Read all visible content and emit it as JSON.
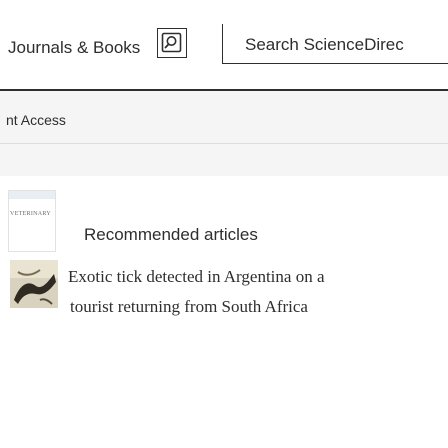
{
  "nav": {
    "journals_books_label": "Journals & Books",
    "search_label": "Search ScienceDirec"
  },
  "access": {
    "text": "nt Access"
  },
  "recommended": {
    "journal_thumb_label": "VETERINARY",
    "title": "Recommended articles",
    "article": {
      "title_line1": "Exotic tick detected in Argentina on a",
      "title_line2": "tourist returning from South Africa"
    }
  },
  "colors": {
    "text": "#2e2e2e",
    "strip_bg": "#f5f5f5"
  }
}
